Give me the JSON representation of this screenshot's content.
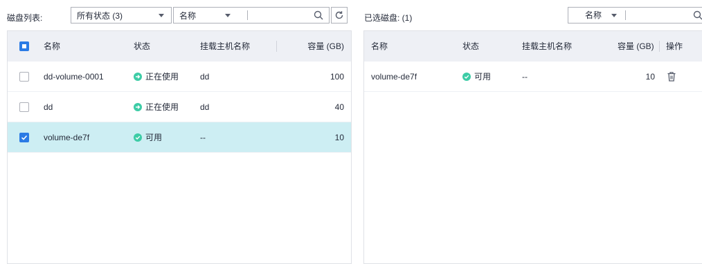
{
  "left": {
    "label": "磁盘列表:",
    "status_filter": "所有状态 (3)",
    "field_select": "名称",
    "search_value": "",
    "columns": {
      "name": "名称",
      "status": "状态",
      "host": "挂载主机名称",
      "capacity": "容量 (GB)"
    },
    "rows": [
      {
        "name": "dd-volume-0001",
        "status": "正在使用",
        "status_kind": "in-use",
        "host": "dd",
        "capacity": "100",
        "checked": false
      },
      {
        "name": "dd",
        "status": "正在使用",
        "status_kind": "in-use",
        "host": "dd",
        "capacity": "40",
        "checked": false
      },
      {
        "name": "volume-de7f",
        "status": "可用",
        "status_kind": "available",
        "host": "--",
        "capacity": "10",
        "checked": true
      }
    ]
  },
  "right": {
    "label": "已选磁盘: (1)",
    "field_select": "名称",
    "search_value": "",
    "columns": {
      "name": "名称",
      "status": "状态",
      "host": "挂载主机名称",
      "capacity": "容量 (GB)",
      "action": "操作"
    },
    "rows": [
      {
        "name": "volume-de7f",
        "status": "可用",
        "status_kind": "available",
        "host": "--",
        "capacity": "10",
        "action_icon": "trash-icon"
      }
    ]
  },
  "colors": {
    "accent": "#2b7be5",
    "status_green": "#3dcca6",
    "selected_row": "#cdeef3",
    "header_bg": "#eef0f5"
  }
}
